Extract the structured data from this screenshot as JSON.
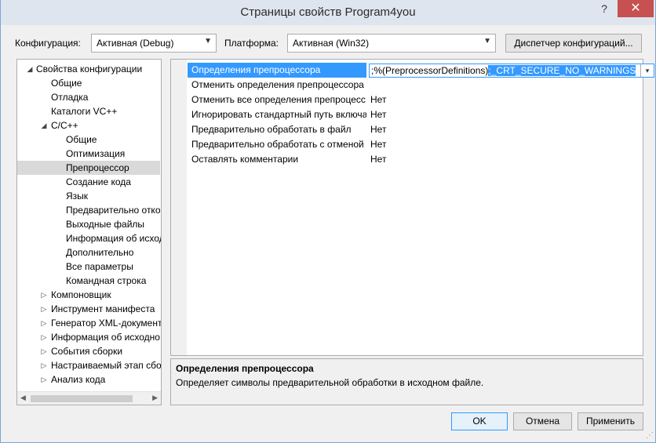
{
  "window": {
    "title": "Страницы свойств Program4you",
    "help_label": "?",
    "close_label": "✕"
  },
  "config_row": {
    "config_label": "Конфигурация:",
    "config_value": "Активная (Debug)",
    "platform_label": "Платформа:",
    "platform_value": "Активная (Win32)",
    "config_manager_label": "Диспетчер конфигураций..."
  },
  "tree": {
    "items": [
      {
        "label": "Свойства конфигурации",
        "glyph": "◢",
        "level": 0
      },
      {
        "label": "Общие",
        "glyph": "",
        "level": 1
      },
      {
        "label": "Отладка",
        "glyph": "",
        "level": 1
      },
      {
        "label": "Каталоги VC++",
        "glyph": "",
        "level": 1
      },
      {
        "label": "C/C++",
        "glyph": "◢",
        "level": 1
      },
      {
        "label": "Общие",
        "glyph": "",
        "level": 2
      },
      {
        "label": "Оптимизация",
        "glyph": "",
        "level": 2
      },
      {
        "label": "Препроцессор",
        "glyph": "",
        "level": 2,
        "selected": true
      },
      {
        "label": "Создание кода",
        "glyph": "",
        "level": 2
      },
      {
        "label": "Язык",
        "glyph": "",
        "level": 2
      },
      {
        "label": "Предварительно отко",
        "glyph": "",
        "level": 2
      },
      {
        "label": "Выходные файлы",
        "glyph": "",
        "level": 2
      },
      {
        "label": "Информация об исход",
        "glyph": "",
        "level": 2
      },
      {
        "label": "Дополнительно",
        "glyph": "",
        "level": 2
      },
      {
        "label": "Все параметры",
        "glyph": "",
        "level": 2
      },
      {
        "label": "Командная строка",
        "glyph": "",
        "level": 2
      },
      {
        "label": "Компоновщик",
        "glyph": "▷",
        "level": 1
      },
      {
        "label": "Инструмент манифеста",
        "glyph": "▷",
        "level": 1
      },
      {
        "label": "Генератор XML-документ",
        "glyph": "▷",
        "level": 1
      },
      {
        "label": "Информация об исходно",
        "glyph": "▷",
        "level": 1
      },
      {
        "label": "События сборки",
        "glyph": "▷",
        "level": 1
      },
      {
        "label": "Настраиваемый этап сбо",
        "glyph": "▷",
        "level": 1
      },
      {
        "label": "Анализ кода",
        "glyph": "▷",
        "level": 1
      }
    ],
    "scroll_left": "◀",
    "scroll_right": "▶"
  },
  "grid": {
    "editor_prefix": ";%(PreprocessorDefinitions)",
    "editor_highlight": ";_CRT_SECURE_NO_WARNINGS",
    "editor_dropdown": "▾",
    "rows": [
      {
        "name": "Определения препроцессора",
        "value": ""
      },
      {
        "name": "Отменить определения препроцессора",
        "value": ""
      },
      {
        "name": "Отменить все определения препроцесс",
        "value": "Нет"
      },
      {
        "name": "Игнорировать стандартный путь включа",
        "value": "Нет"
      },
      {
        "name": "Предварительно обработать в файл",
        "value": "Нет"
      },
      {
        "name": "Предварительно обработать с отменой н",
        "value": "Нет"
      },
      {
        "name": "Оставлять комментарии",
        "value": "Нет"
      }
    ]
  },
  "description": {
    "title": "Определения препроцессора",
    "text": "Определяет символы предварительной обработки в исходном файле."
  },
  "buttons": {
    "ok": "OK",
    "cancel": "Отмена",
    "apply": "Применить"
  }
}
